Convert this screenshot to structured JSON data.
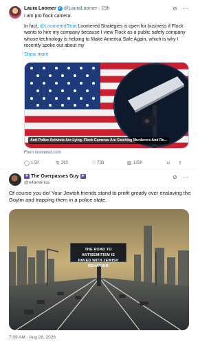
{
  "tweet1": {
    "name": "Laura Loomer",
    "handle": "@LauraLoomer",
    "time": "19h",
    "line1": "I am pro flock camera.",
    "body_pre": "In fact, ",
    "mention": "@LoomeredStrat",
    "body_post": " Loomered Strategies is open for business if Flock wants to hire my company because I view Flock as a public safety company whose technology is helping to Make America Safe Again, which is why I recently spoke out about my",
    "show_more": "Show more",
    "image_caption": "Anti-Police Activists Are Lying. Flock Cameras Are Catching Murderers And Re...",
    "source": "From loomered.com",
    "stats": {
      "replies": "1.5K",
      "reposts": "263",
      "likes": "739",
      "views": "135K"
    }
  },
  "tweet2": {
    "name": "The Overpasses Guy",
    "handle": "@o4america",
    "text": "Of course you do! Your Jewish friends stand to profit greatly over enslaving the Goylm and trapping them in a police state.",
    "billboard_line1": "THE ROAD TO ANTISEMITISM IS",
    "billboard_line2": "PAVED WITH JEWISH BEHAVIOR",
    "timestamp": "7:09 AM · Aug 28, 2026"
  },
  "icons": {
    "grok": "grok-icon",
    "more": "more-icon",
    "reply": "reply-icon",
    "repost": "repost-icon",
    "like": "like-icon",
    "views": "views-icon",
    "bookmark": "bookmark-icon",
    "share": "share-icon"
  },
  "colors": {
    "accent": "#1d9bf0",
    "muted": "#536471",
    "text": "#0f1419"
  }
}
